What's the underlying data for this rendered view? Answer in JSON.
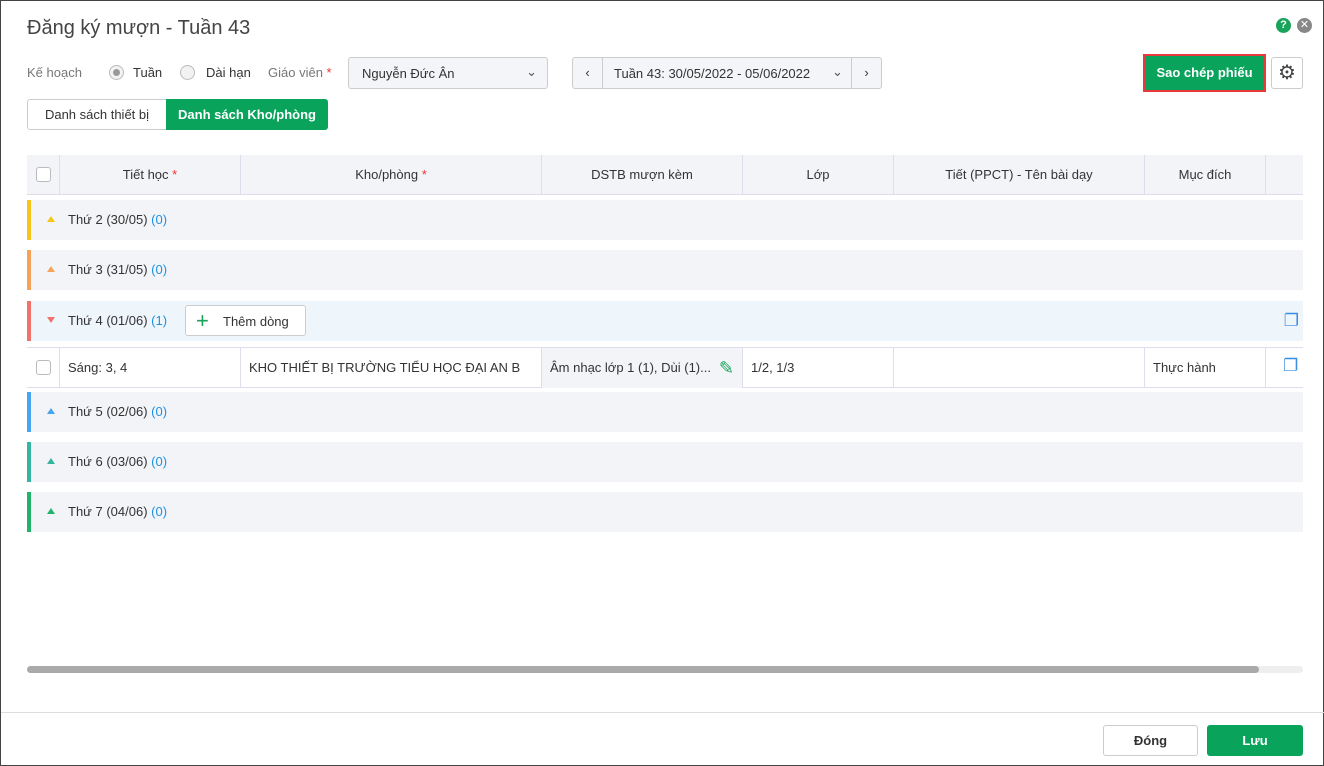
{
  "title": "Đăng ký mượn - Tuần 43",
  "help_icon": "?",
  "filters": {
    "plan_label": "Kế hoạch",
    "plan_week": "Tuần",
    "plan_long": "Dài hạn",
    "plan_selected": "Tuần",
    "teacher_label": "Giáo viên",
    "required": "*",
    "teacher_value": "Nguyễn Đức Ân",
    "week_value": "Tuần 43: 30/05/2022 - 05/06/2022"
  },
  "copy_button": "Sao chép phiếu",
  "tabs": [
    {
      "label": "Danh sách thiết bị",
      "active": false
    },
    {
      "label": "Danh sách Kho/phòng",
      "active": true
    }
  ],
  "columns": [
    "Tiết học",
    "Kho/phòng",
    "DSTB mượn kèm",
    "Lớp",
    "Tiết (PPCT) - Tên bài dạy",
    "Mục đích"
  ],
  "groups": [
    {
      "label": "Thứ 2 (30/05)",
      "count": "(0)",
      "color": "#f5c518",
      "expanded": false
    },
    {
      "label": "Thứ 3 (31/05)",
      "count": "(0)",
      "color": "#f5a35a",
      "expanded": false
    },
    {
      "label": "Thứ 4 (01/06)",
      "count": "(1)",
      "color": "#f0736b",
      "expanded": true,
      "add_label": "Thêm dòng"
    },
    {
      "label": "Thứ 5 (02/06)",
      "count": "(0)",
      "color": "#45a5ee",
      "expanded": false
    },
    {
      "label": "Thứ 6 (03/06)",
      "count": "(0)",
      "color": "#34b5a0",
      "expanded": false
    },
    {
      "label": "Thứ 7 (04/06)",
      "count": "(0)",
      "color": "#22b36a",
      "expanded": false
    }
  ],
  "row": {
    "period": "Sáng: 3, 4",
    "room": "KHO THIẾT BỊ TRƯỜNG TIỂU HỌC ĐẠI AN B",
    "equipment": "Âm nhạc lớp 1 (1), Dùi (1)...",
    "class": "1/2, 1/3",
    "lesson": "",
    "purpose": "Thực hành"
  },
  "footer": {
    "close": "Đóng",
    "save": "Lưu"
  },
  "accent": "#0aa35c"
}
